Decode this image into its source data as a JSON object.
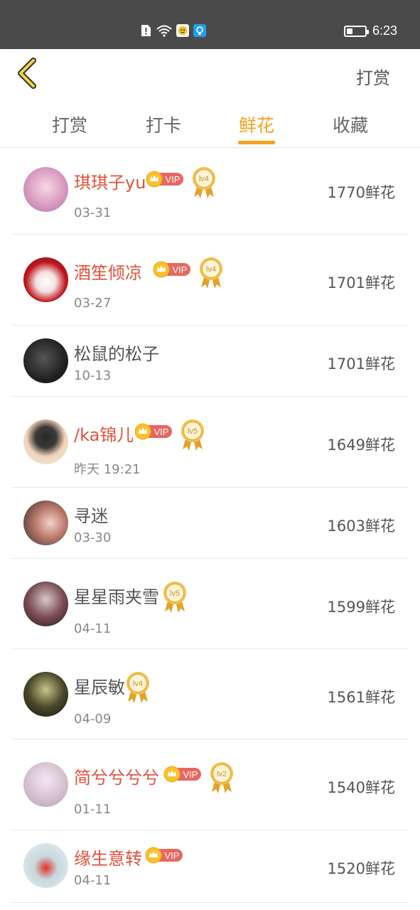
{
  "status_bar": {
    "time": "6:23",
    "battery_fraction": 0.35,
    "icons": [
      "sim-alert-icon",
      "wifi-icon",
      "app-notification-icon",
      "tip-notification-icon"
    ]
  },
  "header": {
    "back_icon": "chevron-left-icon",
    "action_label": "打赏"
  },
  "tabs": [
    {
      "label": "打赏"
    },
    {
      "label": "打卡"
    },
    {
      "label": "鲜花",
      "active": true
    },
    {
      "label": "收藏"
    }
  ],
  "colors": {
    "accent": "#f5a21a",
    "vip_name": "#e0523a",
    "status_bar": "#4a4a4a"
  },
  "vip_label": "VIP",
  "list": [
    {
      "name": "琪琪子yu",
      "date": "03-31",
      "amount": "1770鲜花",
      "vip": true,
      "level": "lv4"
    },
    {
      "name": "酒笙倾凉",
      "date": "03-27",
      "amount": "1701鲜花",
      "vip": true,
      "level": "lv4"
    },
    {
      "name": "松鼠的松子",
      "date": "10-13",
      "amount": "1701鲜花",
      "vip": false,
      "level": ""
    },
    {
      "name": "/ka锦儿",
      "date": "昨天 19:21",
      "amount": "1649鲜花",
      "vip": true,
      "level": "lv5"
    },
    {
      "name": "寻迷",
      "date": "03-30",
      "amount": "1603鲜花",
      "vip": false,
      "level": ""
    },
    {
      "name": "星星雨夹雪",
      "date": "04-11",
      "amount": "1599鲜花",
      "vip": false,
      "level": "lv5"
    },
    {
      "name": "星辰敏",
      "date": "04-09",
      "amount": "1561鲜花",
      "vip": false,
      "level": "lv4"
    },
    {
      "name": "简兮兮兮兮",
      "date": "01-11",
      "amount": "1540鲜花",
      "vip": true,
      "level": "lv2"
    },
    {
      "name": "缘生意转",
      "date": "04-11",
      "amount": "1520鲜花",
      "vip": true,
      "level": ""
    }
  ]
}
